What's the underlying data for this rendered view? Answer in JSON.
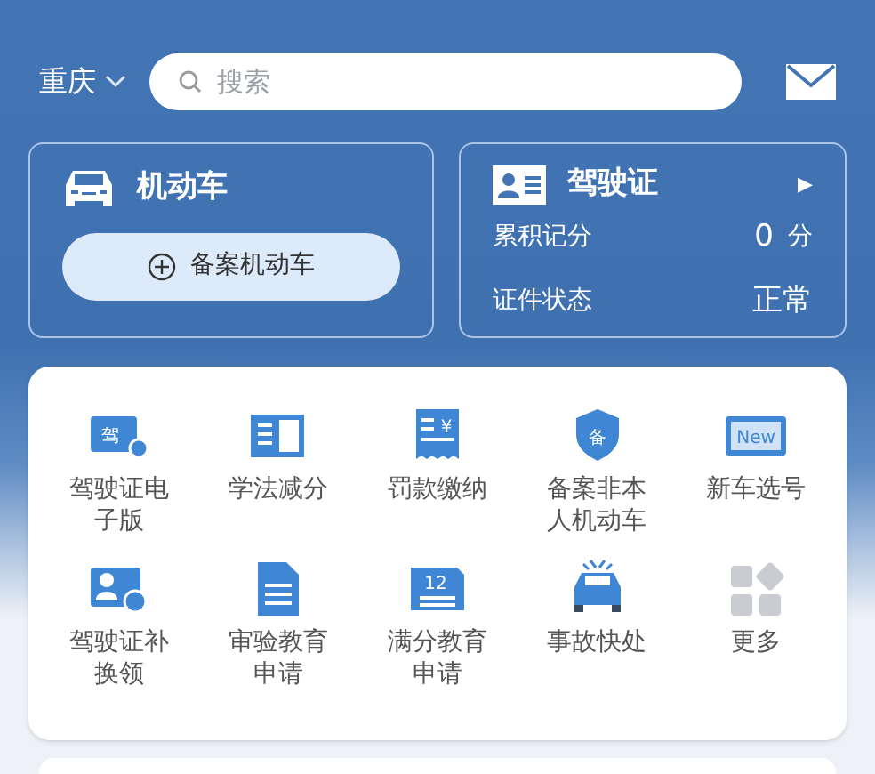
{
  "header": {
    "city": "重庆",
    "search": {
      "placeholder": "搜索"
    }
  },
  "vehicle_card": {
    "title": "机动车",
    "button": "备案机动车"
  },
  "license_card": {
    "title": "驾驶证",
    "arrow": "▶",
    "rows": [
      {
        "label": "累积记分",
        "value": "0",
        "unit": "分"
      },
      {
        "label": "证件状态",
        "value": "正常"
      }
    ]
  },
  "services": [
    {
      "kind": "ecard",
      "icon_text": "驾",
      "label": "驾驶证电子版"
    },
    {
      "kind": "book",
      "label": "学法减分"
    },
    {
      "kind": "receipt",
      "icon_text": "¥",
      "label": "罚款缴纳"
    },
    {
      "kind": "shield",
      "icon_text": "备",
      "label": "备案非本人机动车"
    },
    {
      "kind": "plate",
      "icon_text": "New",
      "label": "新车选号"
    },
    {
      "kind": "idcard",
      "label": "驾驶证补换领"
    },
    {
      "kind": "doc",
      "label": "审验教育申请"
    },
    {
      "kind": "calendar",
      "icon_text": "12",
      "label": "满分教育申请"
    },
    {
      "kind": "crash",
      "label": "事故快处"
    },
    {
      "kind": "more",
      "label": "更多"
    }
  ]
}
